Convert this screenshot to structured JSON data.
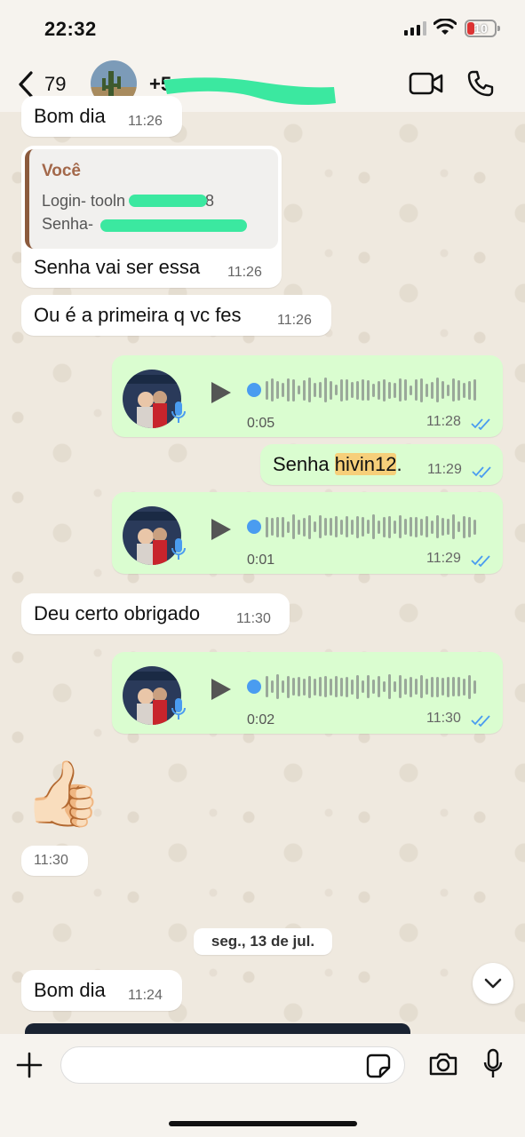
{
  "status_bar": {
    "time": "22:32",
    "battery": "10"
  },
  "header": {
    "back_count": "79",
    "contact_name": "+5",
    "icons": [
      "back-chevron-icon",
      "video-call-icon",
      "phone-icon"
    ]
  },
  "messages": [
    {
      "text": "Bom dia",
      "time": "11:26",
      "direction": "in"
    },
    {
      "quote_author": "Você",
      "quote_line1": "Login- tooln",
      "quote_line1_tail": "8",
      "quote_line2": "Senha-",
      "text": "Senha vai ser essa",
      "time": "11:26",
      "direction": "in"
    },
    {
      "text": "Ou é a primeira q vc fes",
      "time": "11:26",
      "direction": "in"
    },
    {
      "type": "voice",
      "duration": "0:05",
      "time": "11:28",
      "direction": "out"
    },
    {
      "text_prefix": "Senha ",
      "text_highlight": "hivin12",
      "text_suffix": ".",
      "time": "11:29",
      "direction": "out"
    },
    {
      "type": "voice",
      "duration": "0:01",
      "time": "11:29",
      "direction": "out"
    },
    {
      "text": "Deu certo obrigado",
      "time": "11:30",
      "direction": "in"
    },
    {
      "type": "voice",
      "duration": "0:02",
      "time": "11:30",
      "direction": "out"
    },
    {
      "type": "emoji",
      "emoji": "👍🏻",
      "time": "11:30",
      "direction": "in"
    },
    {
      "text": "Bom dia",
      "time": "11:24",
      "direction": "in"
    }
  ],
  "date_separator": "seg., 13 de jul.",
  "composer": {
    "placeholder": ""
  },
  "colors": {
    "outgoing_bubble": "#dafdd0",
    "incoming_bubble": "#ffffff",
    "read_ticks": "#4a9cf0",
    "highlight": "#f6cf7a",
    "quote_author": "#a3684a"
  }
}
